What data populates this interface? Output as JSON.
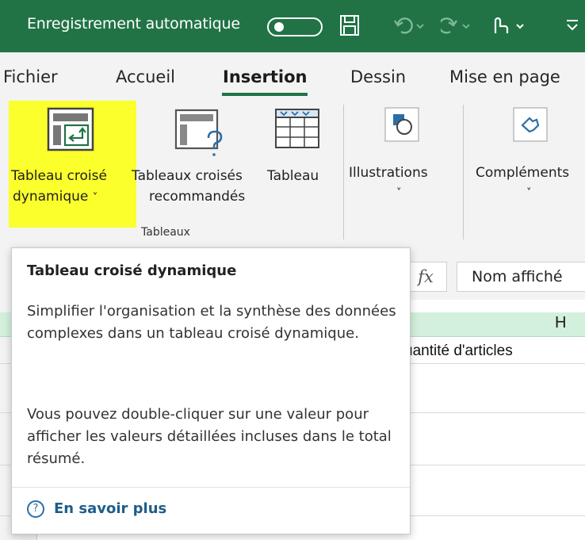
{
  "titlebar": {
    "autosave_label": "Enregistrement automatique"
  },
  "tabs": [
    {
      "label": "Fichier"
    },
    {
      "label": "Accueil"
    },
    {
      "label": "Insertion"
    },
    {
      "label": "Dessin"
    },
    {
      "label": "Mise en page"
    }
  ],
  "ribbon": {
    "pivot_line1": "Tableau croisé",
    "pivot_line2": "dynamique",
    "recommended_line1": "Tableaux croisés",
    "recommended_line2": "recommandés",
    "table_label": "Tableau",
    "group_label": "Tableaux",
    "illustrations_label": "Illustrations",
    "complements_label": "Compléments"
  },
  "formula_bar": {
    "fx": "fx",
    "name_value": "Nom affiché"
  },
  "grid": {
    "column_header": "H",
    "cell_text": "uantité d'articles"
  },
  "tooltip": {
    "title": "Tableau croisé dynamique",
    "para1": "Simplifier l'organisation et la synthèse des données complexes dans un tableau croisé dynamique.",
    "para2": "Vous pouvez double-cliquer sur une valeur pour afficher les valeurs détaillées incluses dans le total résumé.",
    "help_icon": "?",
    "help_link": "En savoir plus"
  },
  "colors": {
    "accent": "#217346",
    "highlight": "#fbff2b",
    "link": "#1f5d8a"
  }
}
